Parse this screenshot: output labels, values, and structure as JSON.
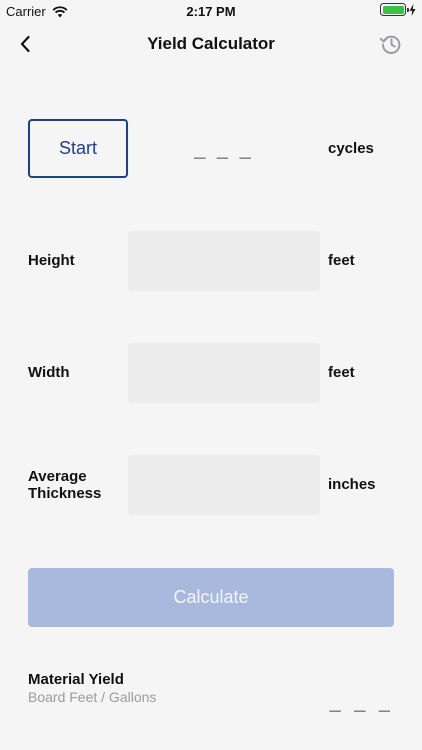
{
  "status_bar": {
    "carrier": "Carrier",
    "time": "2:17 PM",
    "battery_level": 1.0,
    "battery_color": "#39c24a"
  },
  "nav": {
    "title": "Yield Calculator",
    "back_icon": "chevron-left-icon",
    "history_icon": "history-icon"
  },
  "start": {
    "button_label": "Start",
    "value": "_ _ _",
    "unit": "cycles"
  },
  "fields": {
    "height": {
      "label": "Height",
      "value": "",
      "unit": "feet"
    },
    "width": {
      "label": "Width",
      "value": "",
      "unit": "feet"
    },
    "thickness": {
      "label_line1": "Average",
      "label_line2": "Thickness",
      "value": "",
      "unit": "inches"
    }
  },
  "calculate": {
    "label": "Calculate",
    "color": "#a9b8dd"
  },
  "result": {
    "title": "Material Yield",
    "subtitle": "Board Feet / Gallons",
    "value": "_ _ _"
  },
  "colors": {
    "accent": "#1f3f8c",
    "background": "#f5f5f6",
    "field_background": "#ececed"
  }
}
